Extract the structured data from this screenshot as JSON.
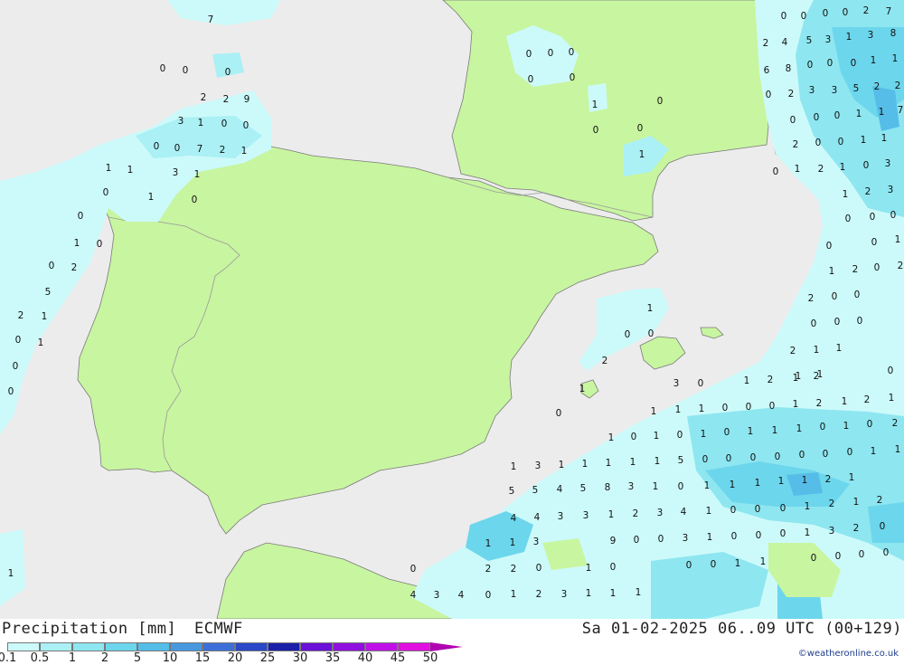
{
  "footer": {
    "title": "Precipitation [mm]",
    "model": "ECMWF",
    "valid": "Sa 01-02-2025 06..09 UTC (00+129)",
    "credit": "©weatheronline.co.uk"
  },
  "scale": {
    "labels": [
      "0.1",
      "0.5",
      "1",
      "2",
      "5",
      "10",
      "15",
      "20",
      "25",
      "30",
      "35",
      "40",
      "45",
      "50"
    ],
    "colors": [
      "#ccfafa",
      "#aaf0f5",
      "#8ee6f0",
      "#6cd6ec",
      "#55bde8",
      "#4898e0",
      "#3c70d8",
      "#2a48c8",
      "#1c20a8",
      "#6a10d8",
      "#9010e0",
      "#c010e8",
      "#e010e0",
      "#c000c0"
    ],
    "arrow_color": "#b000b0"
  },
  "colors": {
    "land": "#c8f5a0",
    "sea": "#ececec",
    "border": "#999999",
    "coast": "#7a7a7a"
  },
  "map_values": [
    "0",
    "0",
    "0",
    "0",
    "2",
    "7",
    "7",
    "0",
    "0",
    "0",
    "0",
    "0",
    "0",
    "0",
    "0",
    "1",
    "0",
    "0",
    "0",
    "1",
    "2",
    "4",
    "5",
    "3",
    "1",
    "3",
    "8",
    "6",
    "8",
    "0",
    "0",
    "0",
    "1",
    "1",
    "0",
    "2",
    "3",
    "3",
    "5",
    "2",
    "2",
    "0",
    "0",
    "0",
    "1",
    "1",
    "7",
    "2",
    "2",
    "9",
    "3",
    "1",
    "0",
    "0",
    "0",
    "0",
    "7",
    "2",
    "1",
    "2",
    "0",
    "0",
    "1",
    "1",
    "1",
    "1",
    "3",
    "1",
    "0",
    "1",
    "0",
    "0",
    "1",
    "2",
    "1",
    "0",
    "3",
    "0",
    "1",
    "0",
    "0",
    "2",
    "5",
    "1",
    "2",
    "3",
    "0",
    "0",
    "0",
    "0",
    "0",
    "1",
    "1",
    "2",
    "0",
    "2",
    "2",
    "1",
    "0",
    "1",
    "0",
    "0",
    "2",
    "0",
    "0",
    "0",
    "0",
    "0",
    "1",
    "0",
    "0",
    "2",
    "1",
    "2",
    "1",
    "1",
    "1",
    "1",
    "0",
    "3",
    "0",
    "1",
    "2",
    "1",
    "2",
    "0",
    "1",
    "1",
    "1",
    "0",
    "0",
    "0",
    "1",
    "2",
    "1",
    "2",
    "1",
    "1",
    "0",
    "1",
    "0",
    "1",
    "0",
    "1",
    "1",
    "1",
    "0",
    "1",
    "0",
    "2",
    "1",
    "3",
    "1",
    "1",
    "1",
    "1",
    "1",
    "5",
    "0",
    "0",
    "0",
    "0",
    "0",
    "0",
    "0",
    "1",
    "1",
    "5",
    "5",
    "4",
    "5",
    "8",
    "3",
    "1",
    "0",
    "1",
    "1",
    "1",
    "1",
    "1",
    "2",
    "1",
    "4",
    "4",
    "3",
    "3",
    "1",
    "2",
    "3",
    "4",
    "1",
    "0",
    "0",
    "0",
    "1",
    "2",
    "1",
    "2",
    "1",
    "1",
    "3",
    "9",
    "0",
    "0",
    "3",
    "1",
    "0",
    "0",
    "0",
    "1",
    "3",
    "2",
    "0",
    "0",
    "2",
    "2",
    "0",
    "1",
    "0",
    "0",
    "0",
    "1",
    "1",
    "0",
    "0",
    "0",
    "0",
    "1",
    "4",
    "3",
    "4",
    "0",
    "1",
    "2",
    "3",
    "1",
    "1",
    "1"
  ]
}
